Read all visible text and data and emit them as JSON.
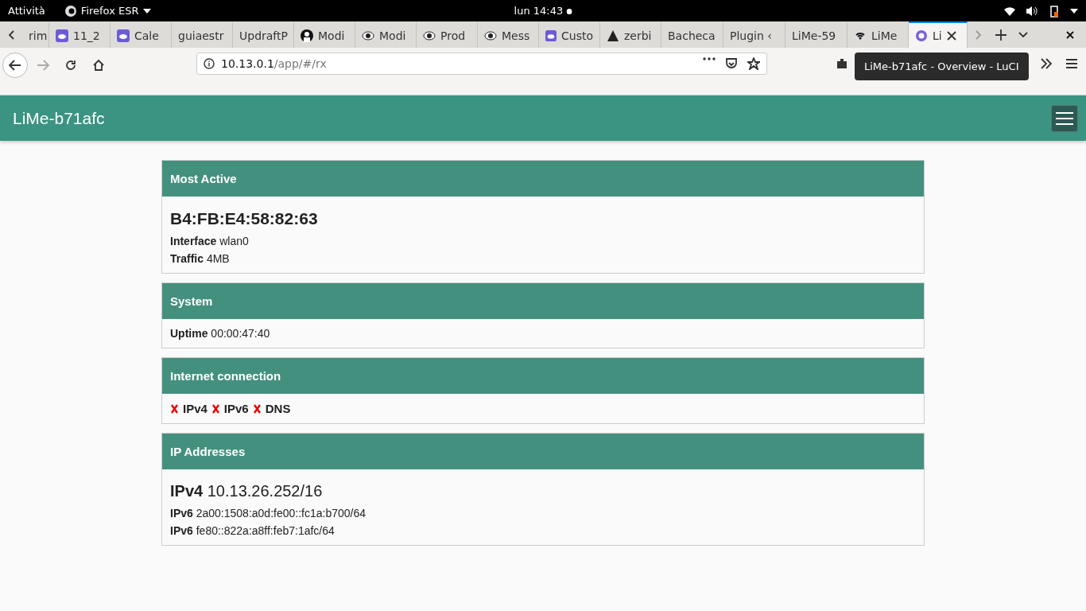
{
  "topbar": {
    "activities": "Attività",
    "app": "Firefox ESR",
    "clock": "lun 14:43"
  },
  "tabs": [
    {
      "label": "rim",
      "kind": "plain",
      "selected": false
    },
    {
      "label": "11_2",
      "kind": "cloud",
      "selected": false
    },
    {
      "label": "Cale",
      "kind": "cloud",
      "selected": false
    },
    {
      "label": "guiaestr",
      "kind": "plain",
      "selected": false
    },
    {
      "label": "UpdraftP",
      "kind": "plain",
      "selected": false
    },
    {
      "label": "Modi",
      "kind": "person",
      "selected": false
    },
    {
      "label": "Modi",
      "kind": "eye",
      "selected": false
    },
    {
      "label": "Prod",
      "kind": "eye",
      "selected": false
    },
    {
      "label": "Mess",
      "kind": "eye",
      "selected": false
    },
    {
      "label": "Custo",
      "kind": "cloud",
      "selected": false
    },
    {
      "label": "zerbi",
      "kind": "warning",
      "selected": false
    },
    {
      "label": "Bacheca",
      "kind": "plain",
      "selected": false
    },
    {
      "label": "Plugin ‹",
      "kind": "plain",
      "selected": false
    },
    {
      "label": "LiMe-59",
      "kind": "plain",
      "selected": false
    },
    {
      "label": "LiMe",
      "kind": "signal",
      "selected": false
    },
    {
      "label": "Li",
      "kind": "circle",
      "selected": true
    }
  ],
  "url": {
    "host": "10.13.0.1",
    "path": "/app/#/rx"
  },
  "tooltip": "LiMe-b71afc - Overview - LuCI",
  "header": {
    "title": "LiMe-b71afc"
  },
  "cards": [
    {
      "kind": "device",
      "title": "Most Active",
      "heading": "B4:FB:E4:58:82:63",
      "rows": [
        {
          "label": "Interface",
          "value": "wlan0"
        },
        {
          "label": "Traffic",
          "value": "4MB"
        }
      ]
    },
    {
      "kind": "rows",
      "title": "System",
      "rows": [
        {
          "label": "Uptime",
          "value": "00:00:47:40"
        }
      ]
    },
    {
      "kind": "checks",
      "title": "Internet connection",
      "checks": [
        {
          "label": "IPv4",
          "ok": false
        },
        {
          "label": "IPv6",
          "ok": false
        },
        {
          "label": "DNS",
          "ok": false
        }
      ]
    },
    {
      "kind": "addresses",
      "title": "IP Addresses",
      "primary": {
        "label": "IPv4",
        "value": "10.13.26.252/16"
      },
      "rows": [
        {
          "label": "IPv6",
          "value": "2a00:1508:a0d:fe00::fc1a:b700/64"
        },
        {
          "label": "IPv6",
          "value": "fe80::822a:a8ff:feb7:1afc/64"
        }
      ]
    }
  ]
}
